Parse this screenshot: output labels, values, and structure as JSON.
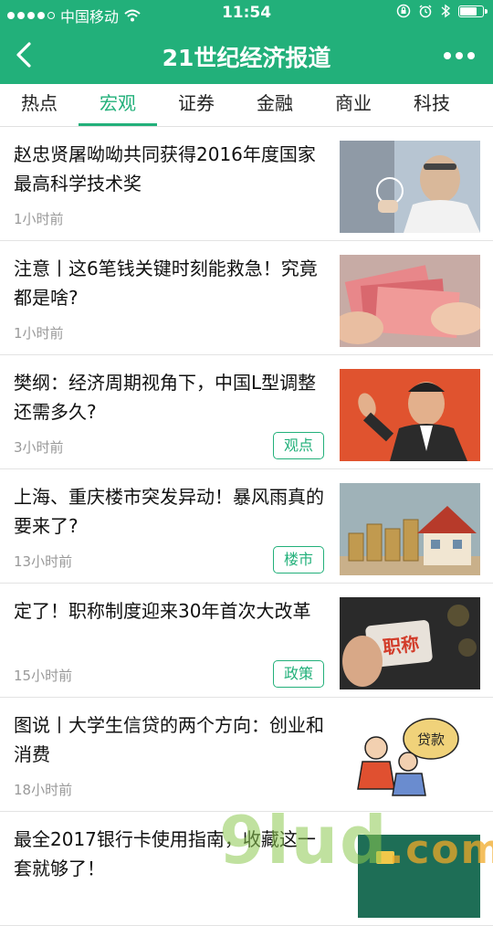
{
  "status_bar": {
    "carrier": "中国移动",
    "time": "11:54",
    "battery_level": 0.8
  },
  "navbar": {
    "title": "21世纪经济报道"
  },
  "tabs": [
    {
      "label": "热点"
    },
    {
      "label": "宏观"
    },
    {
      "label": "证券"
    },
    {
      "label": "金融"
    },
    {
      "label": "商业"
    },
    {
      "label": "科技"
    }
  ],
  "active_tab": "宏观",
  "articles": [
    {
      "title": "赵忠贤屠呦呦共同获得2016年度国家最高科学技术奖",
      "time": "1小时前",
      "tag": "",
      "image": "scientist"
    },
    {
      "title": "注意丨这6笔钱关键时刻能救急！究竟都是啥?",
      "time": "1小时前",
      "tag": "",
      "image": "money"
    },
    {
      "title": "樊纲：经济周期视角下，中国L型调整还需多久?",
      "time": "3小时前",
      "tag": "观点",
      "image": "speaker"
    },
    {
      "title": "上海、重庆楼市突发异动！暴风雨真的要来了?",
      "time": "13小时前",
      "tag": "楼市",
      "image": "house"
    },
    {
      "title": "定了！职称制度迎来30年首次大改革",
      "time": "15小时前",
      "tag": "政策",
      "image": "card",
      "image_text": "职称"
    },
    {
      "title": "图说丨大学生信贷的两个方向：创业和消费",
      "time": "18小时前",
      "tag": "",
      "image": "cartoon",
      "image_text": "贷款"
    },
    {
      "title": "最全2017银行卡使用指南，收藏这一套就够了！",
      "time": "",
      "tag": "",
      "image": "bankcard"
    }
  ],
  "watermark": {
    "main": "9lud",
    "suffix": ".com"
  },
  "colors": {
    "brand": "#22b07a",
    "muted": "#999999",
    "text": "#111111"
  }
}
